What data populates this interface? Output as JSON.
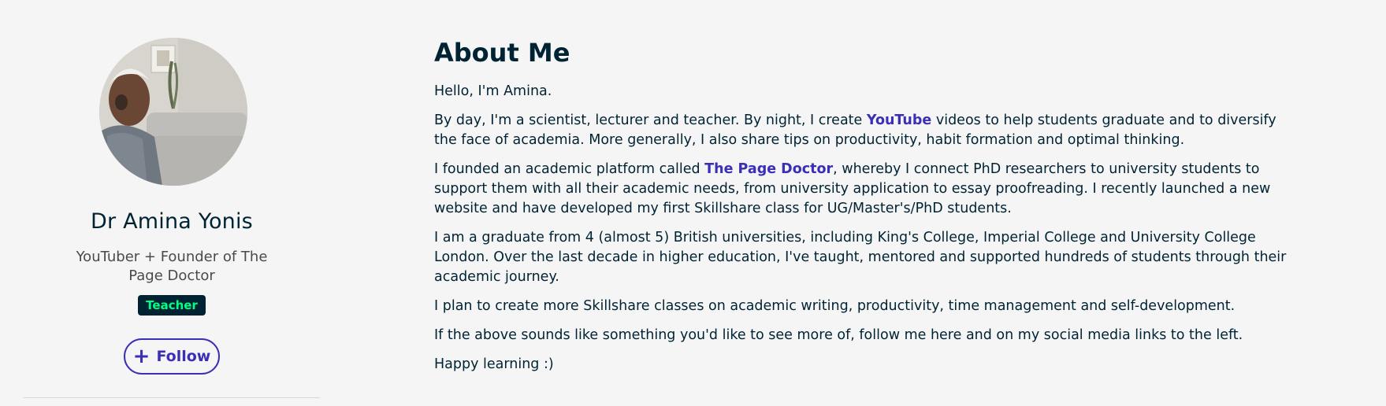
{
  "profile": {
    "name": "Dr Amina Yonis",
    "tagline": "YouTuber + Founder of The Page Doctor",
    "badge": "Teacher",
    "follow_label": "Follow"
  },
  "about": {
    "heading": "About Me",
    "p1": "Hello, I'm Amina.",
    "p2": {
      "before": "By day, I'm a scientist, lecturer and teacher. By night, I create ",
      "link": "YouTube",
      "after": " videos to help students graduate and to diversify the face of academia. More generally, I also share tips on productivity, habit formation and optimal thinking."
    },
    "p3": {
      "before": "I founded an academic platform called ",
      "link": "The Page Doctor",
      "after": ", whereby I connect PhD researchers to university students to support them with all their academic needs, from university application to essay proofreading. I recently launched a new website and have developed my first Skillshare class for UG/Master's/PhD students."
    },
    "p4": "I am a graduate from 4 (almost 5) British universities, including King's College, Imperial College and University College London. Over the last decade in higher education, I've taught, mentored and supported hundreds of students through their academic journey.",
    "p5": "I plan to create more Skillshare classes on academic writing, productivity, time management and self-development.",
    "p6": "If the above sounds like something you'd like to see more of, follow me here and on my social media links to the left.",
    "p7": "Happy learning :)"
  },
  "colors": {
    "accent": "#3b2fb6",
    "text": "#002333",
    "badge_bg": "#002333",
    "badge_text": "#00ff84",
    "background": "#f5f5f5"
  }
}
